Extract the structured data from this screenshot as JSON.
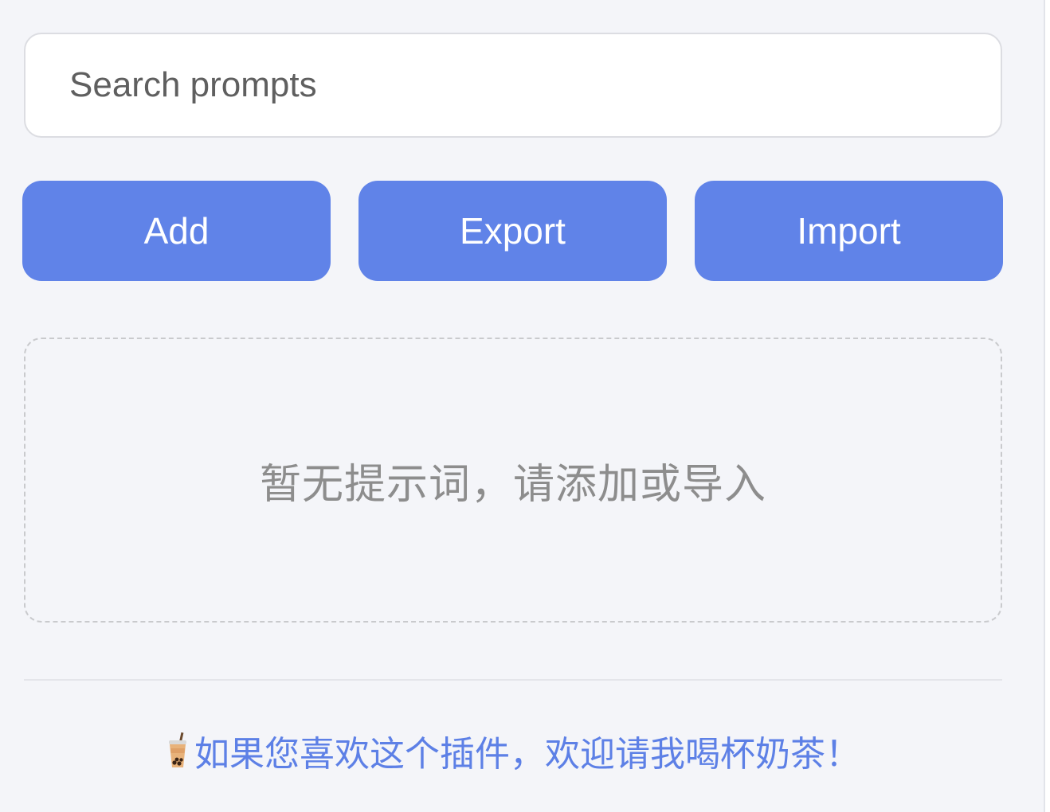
{
  "search": {
    "placeholder": "Search prompts",
    "value": ""
  },
  "toolbar": {
    "add_label": "Add",
    "export_label": "Export",
    "import_label": "Import"
  },
  "prompt_list": {
    "empty_message": "暂无提示词，请添加或导入",
    "items": []
  },
  "footer": {
    "icon": "bubble-tea-icon",
    "text": "如果您喜欢这个插件，欢迎请我喝杯奶茶！"
  },
  "colors": {
    "background": "#f4f5f9",
    "button": "#6083e8",
    "link": "#5d80e6",
    "empty_text": "#8d8d8d"
  }
}
